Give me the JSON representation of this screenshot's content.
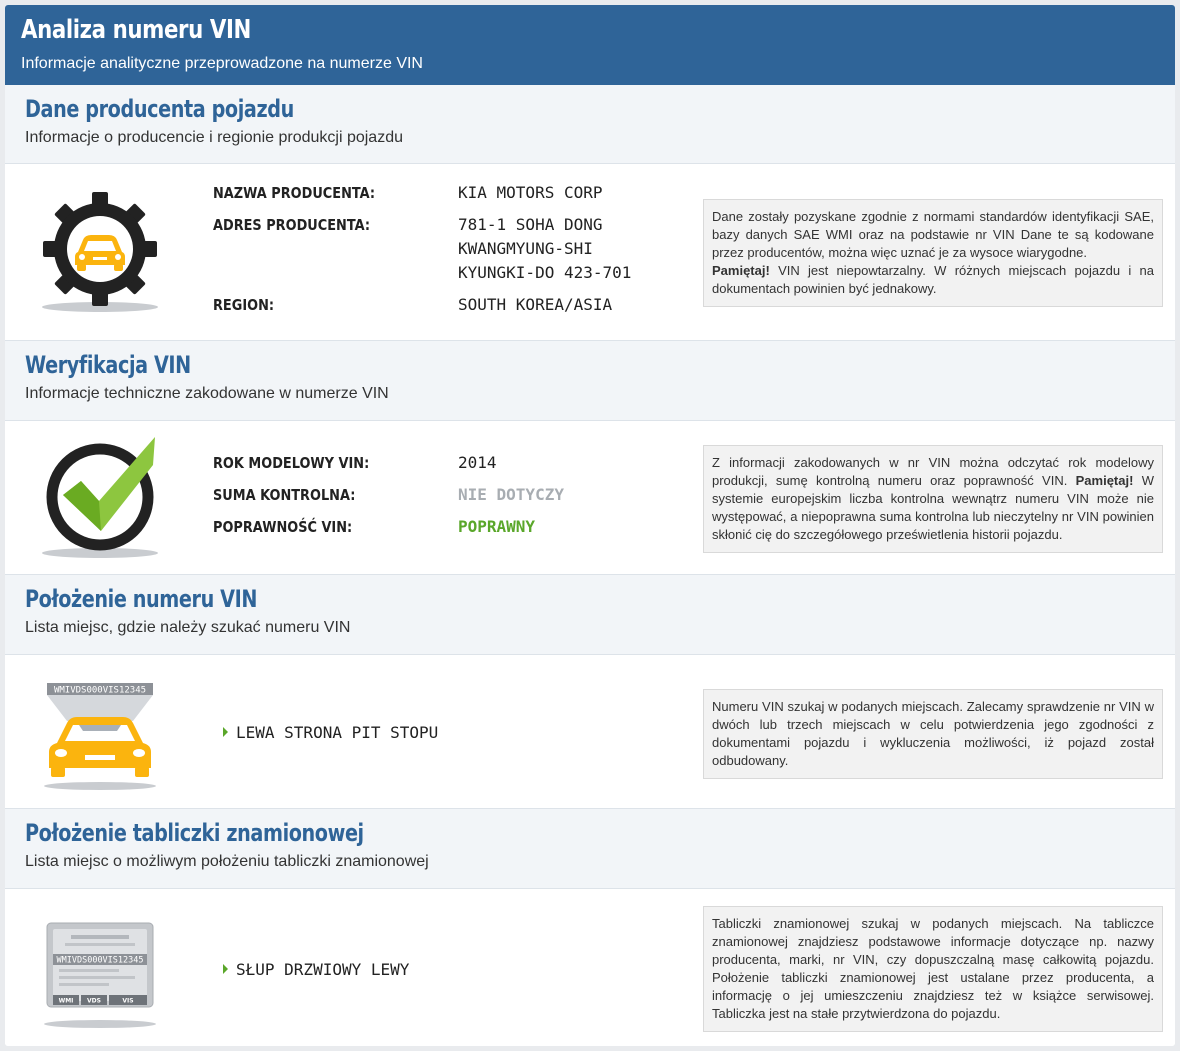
{
  "header": {
    "title": "Analiza numeru VIN",
    "subtitle": "Informacje analityczne przeprowadzone na numerze VIN"
  },
  "colors": {
    "accent": "#2f6498",
    "ok": "#5aa72a",
    "icon_yellow": "#fbb40e"
  },
  "manufacturer": {
    "title": "Dane producenta pojazdu",
    "subtitle": "Informacje o producencie i regionie produkcji pojazdu",
    "icon": "gear-car-icon",
    "fields": {
      "name_label": "NAZWA PRODUCENTA:",
      "name_value": "KIA MOTORS CORP",
      "address_label": "ADRES PRODUCENTA:",
      "address_line1": "781-1 SOHA DONG",
      "address_line2": "KWANGMYUNG-SHI",
      "address_line3": "KYUNGKI-DO 423-701",
      "region_label": "REGION:",
      "region_value": "SOUTH KOREA/ASIA"
    },
    "note_text": "Dane zostały pozyskane zgodnie z normami standardów identyfikacji SAE, bazy danych SAE WMI oraz na podstawie nr VIN Dane te są kodowane przez producentów, można więc uznać je za wysoce wiarygodne.",
    "note_bold": "Pamiętaj!",
    "note_after": " VIN jest niepowtarzalny. W różnych miejscach pojazdu i na dokumentach powinien być jednakowy."
  },
  "verification": {
    "title": "Weryfikacja VIN",
    "subtitle": "Informacje techniczne zakodowane w numerze VIN",
    "icon": "checkmark-icon",
    "fields": {
      "year_label": "ROK MODELOWY VIN:",
      "year_value": "2014",
      "checksum_label": "SUMA KONTROLNA:",
      "checksum_value": "NIE DOTYCZY",
      "valid_label": "POPRAWNOŚĆ VIN:",
      "valid_value": "POPRAWNY"
    },
    "note_text": "Z informacji zakodowanych w nr VIN można odczytać rok modelowy produkcji, sumę kontrolną numeru oraz poprawność VIN. ",
    "note_bold": "Pamiętaj!",
    "note_after": " W systemie europejskim liczba kontrolna wewnątrz numeru VIN może nie występować, a niepoprawna suma kontrolna lub nieczytelny nr VIN powinien skłonić cię do szczegółowego prześwietlenia historii pojazdu."
  },
  "vin_location": {
    "title": "Położenie numeru VIN",
    "subtitle": "Lista miejsc, gdzie należy szukać numeru VIN",
    "icon": "car-windshield-vin-icon",
    "icon_text": "WMIVDS000VIS12345",
    "location": "LEWA STRONA PIT STOPU",
    "note_text": "Numeru VIN szukaj w podanych miejscach. Zalecamy sprawdzenie nr VIN w dwóch lub trzech miejscach w celu potwierdzenia jego zgodności z dokumentami pojazdu i wykluczenia możliwości, iż pojazd został odbudowany."
  },
  "plate_location": {
    "title": "Położenie tabliczki znamionowej",
    "subtitle": "Lista miejsc o możliwym położeniu tabliczki znamionowej",
    "icon": "nameplate-icon",
    "icon_text": "WMIVDS000VIS12345",
    "icon_wmi": "WMI",
    "icon_vds": "VDS",
    "icon_vis": "VIS",
    "location": "SŁUP DRZWIOWY LEWY",
    "note_text": "Tabliczki znamionowej szukaj w podanych miejscach. Na tabliczce znamionowej znajdziesz podstawowe informacje dotyczące np. nazwy producenta, marki, nr VIN, czy dopuszczalną masę całkowitą pojazdu. Położenie tabliczki znamionowej jest ustalane przez producenta, a informację o jej umieszczeniu znajdziesz też w książce serwisowej. Tabliczka jest na stałe przytwierdzona do pojazdu."
  }
}
